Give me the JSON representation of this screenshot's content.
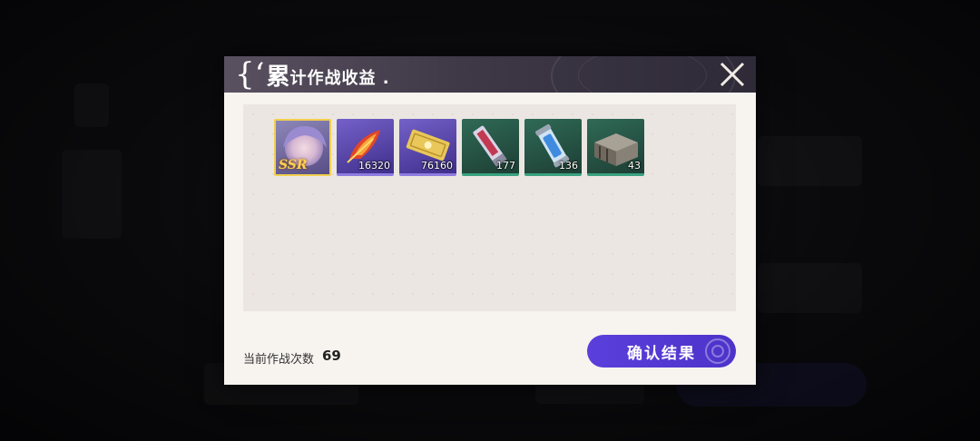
{
  "modal": {
    "title_first_char": "累",
    "title_rest": "计作战收益 .",
    "close_icon": "close-icon"
  },
  "rewards": [
    {
      "name": "ssr-character-card",
      "label": "SSR",
      "count": "",
      "rarity": "SSR",
      "icon": "character-portrait-icon"
    },
    {
      "name": "flame-feather-item",
      "count": "16320",
      "rarity": "purple",
      "icon": "flame-feather-icon"
    },
    {
      "name": "gold-ticket-item",
      "count": "76160",
      "rarity": "purple",
      "icon": "gold-ticket-icon"
    },
    {
      "name": "crystal-bar-item",
      "count": "177",
      "rarity": "green",
      "icon": "crystal-bar-icon"
    },
    {
      "name": "energy-vial-item",
      "count": "136",
      "rarity": "green",
      "icon": "energy-vial-icon"
    },
    {
      "name": "supply-crate-item",
      "count": "43",
      "rarity": "green",
      "icon": "supply-crate-icon"
    }
  ],
  "footer": {
    "battle_count_label": "当前作战次数",
    "battle_count_value": "69",
    "confirm_label": "确认结果"
  },
  "colors": {
    "confirm_button": "#5a3fdc",
    "ssr_border": "#f2cf4e",
    "purple_rarity": "#8e7ce0",
    "green_rarity": "#3aa27e"
  }
}
